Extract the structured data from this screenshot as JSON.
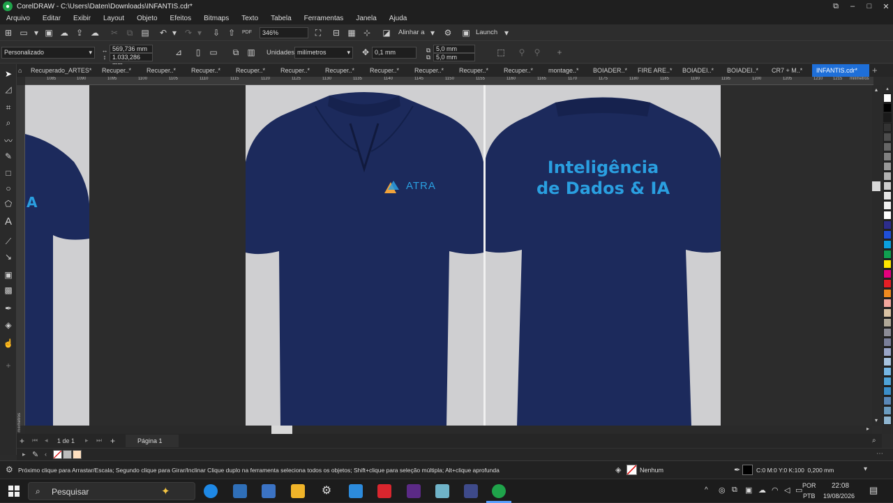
{
  "window": {
    "title": "CorelDRAW - C:\\Users\\Daten\\Downloads\\INFANTIS.cdr*",
    "app_icon": "coreldraw-icon"
  },
  "menu": [
    "Arquivo",
    "Editar",
    "Exibir",
    "Layout",
    "Objeto",
    "Efeitos",
    "Bitmaps",
    "Texto",
    "Tabela",
    "Ferramentas",
    "Janela",
    "Ajuda"
  ],
  "standard_bar": {
    "zoom": "346%",
    "align_label": "Alinhar a",
    "launch_label": "Launch",
    "pdf_label": "PDF"
  },
  "property_bar": {
    "preset": "Personalizado",
    "width": "569,736 mm",
    "height": "1.033,286 mm",
    "units_label": "Unidades:",
    "units_value": "milímetros",
    "nudge": "0,1 mm",
    "dup_x": "5,0 mm",
    "dup_y": "5,0 mm"
  },
  "doc_tabs": [
    "Recuperado_ARTES*",
    "Recuper..*",
    "Recuper..*",
    "Recuper..*",
    "Recuper..*",
    "Recuper..*",
    "Recuper..*",
    "Recuper..*",
    "Recuper..*",
    "Recuper..*",
    "Recuper..*",
    "montage..*",
    "BOIADER..*",
    "FIRE ARE..*",
    "BOIADEI..*",
    "BOIADEI..*",
    "CR7 + M..*",
    "INFANTIS.cdr*"
  ],
  "ruler": {
    "ticks": [
      "1085",
      "1090",
      "1095",
      "1100",
      "1105",
      "1110",
      "1115",
      "1120",
      "1125",
      "1130",
      "1135",
      "1140",
      "1145",
      "1150",
      "1155",
      "1160",
      "1165",
      "1170",
      "1175",
      "1180",
      "1185",
      "1190",
      "1195",
      "1200",
      "1205",
      "1210",
      "1215"
    ],
    "unit": "milímetros",
    "left_unit": "milímetros"
  },
  "canvas": {
    "logo_text": "ATRA",
    "back_text_line1": "Inteligência",
    "back_text_line2": "de Dados & IA",
    "left_partial_text": "A"
  },
  "colors": {
    "shirt": "#1c2a5c",
    "accent_text": "#2a9fe0",
    "active_tab": "#1e6fd9",
    "photo_bg": "#cfcfd1"
  },
  "palette": [
    "#ffffff",
    "#000000",
    "#1a1a1a",
    "#333333",
    "#4d4d4d",
    "#666666",
    "#808080",
    "#999999",
    "#b3b3b3",
    "#cccccc",
    "#e6e6e6",
    "#f2f2f2",
    "#ffffff",
    "#2d2d8c",
    "#1f4fd9",
    "#0aa0e0",
    "#10a050",
    "#ffe600",
    "#e6007e",
    "#e51e25",
    "#f08a1e",
    "#f4a79d",
    "#d9c2a3",
    "#b0a898",
    "#8c8c96",
    "#7a7f99",
    "#9aa6c8",
    "#a8c4e0",
    "#76b7e5",
    "#4fa3d8",
    "#3b8ec9",
    "#5a88b8",
    "#6b9cc0",
    "#8fb5d0"
  ],
  "page_nav": {
    "page_of": "1 de 1",
    "page_label": "Página 1"
  },
  "status": {
    "hint": "Próximo clique para Arrastar/Escala; Segundo clique para Girar/Inclinar Clique duplo na ferramenta seleciona todos os objetos; Shift+clique para seleção múltipla; Alt+clique aprofunda",
    "fill_label": "Nenhum",
    "outline_info": "C:0 M:0 Y:0 K:100  0,200 mm"
  },
  "taskbar": {
    "search_placeholder": "Pesquisar",
    "lang_top": "POR",
    "lang_bottom": "PTB",
    "time": "22:08",
    "date": "19/08/2026"
  }
}
